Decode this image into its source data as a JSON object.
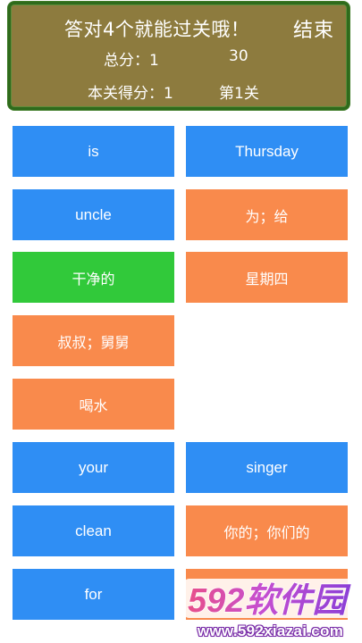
{
  "header": {
    "title": "答对4个就能过关哦！",
    "end_button": "结束",
    "score_label": "总分：1",
    "score_total": "30",
    "level_score_label": "本关得分：1",
    "level_name": "第1关"
  },
  "cards": [
    {
      "text": "is",
      "color": "#2f8ef4"
    },
    {
      "text": "Thursday",
      "color": "#2f8ef4"
    },
    {
      "text": "uncle",
      "color": "#2f8ef4"
    },
    {
      "text": "为；给",
      "color": "#f98a4c"
    },
    {
      "text": "干净的",
      "color": "#31c93a"
    },
    {
      "text": "星期四",
      "color": "#f98a4c"
    },
    {
      "text": "叔叔；舅舅",
      "color": "#f98a4c"
    },
    {
      "text": "喝水",
      "color": "#f98a4c"
    },
    {
      "text": "your",
      "color": "#2f8ef4"
    },
    {
      "text": "singer",
      "color": "#2f8ef4"
    },
    {
      "text": "clean",
      "color": "#2f8ef4"
    },
    {
      "text": "你的；你们的",
      "color": "#f98a4c"
    },
    {
      "text": "for",
      "color": "#2f8ef4"
    }
  ],
  "watermark": {
    "logo": "592软件园",
    "url": "www.592xiazai.com"
  }
}
